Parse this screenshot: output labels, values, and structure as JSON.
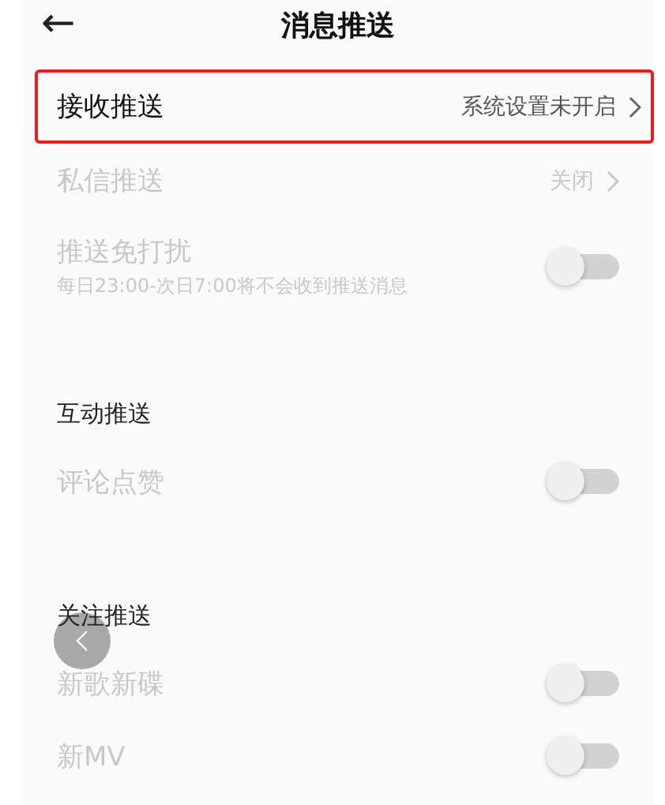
{
  "header": {
    "back": "←",
    "title": "消息推送"
  },
  "items": [
    {
      "kind": "link",
      "label": "接收推送",
      "value": "系统设置未开启",
      "disabled": false,
      "highlighted": true
    },
    {
      "kind": "link",
      "label": "私信推送",
      "value": "关闭",
      "disabled": true,
      "highlighted": false
    },
    {
      "kind": "toggle",
      "label": "推送免打扰",
      "sub": "每日23:00-次日7:00将不会收到推送消息",
      "on": false,
      "disabled": true
    },
    {
      "kind": "section",
      "label": "互动推送"
    },
    {
      "kind": "toggle",
      "label": "评论点赞",
      "on": false,
      "disabled": true
    },
    {
      "kind": "section",
      "label": "关注推送"
    },
    {
      "kind": "toggle",
      "label": "新歌新碟",
      "on": false,
      "disabled": true
    },
    {
      "kind": "toggle",
      "label": "新MV",
      "on": false,
      "disabled": true
    }
  ],
  "floating_back": {
    "kind": "button"
  }
}
